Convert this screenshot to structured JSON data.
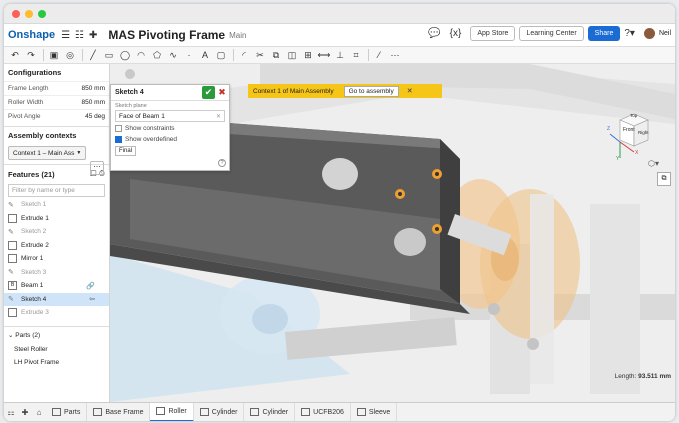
{
  "app": {
    "logo": "Onshape",
    "title": "MAS Pivoting Frame",
    "workspace": "Main",
    "app_store": "App Store",
    "learning_center": "Learning Center",
    "share": "Share",
    "user": "Neil"
  },
  "toolbar_icons": [
    "undo-icon",
    "redo-icon",
    "sketch-icon",
    "line-icon",
    "rectangle-icon",
    "circle-icon",
    "arc-icon",
    "polygon-icon",
    "spline-icon",
    "point-icon",
    "text-icon",
    "image-icon",
    "fillet-icon",
    "trim-icon",
    "offset-icon",
    "mirror-icon",
    "pattern-icon",
    "dimension-icon",
    "constraint-icon"
  ],
  "configurations": {
    "title": "Configurations",
    "rows": [
      {
        "label": "Frame Length",
        "value": "850 mm"
      },
      {
        "label": "Roller Width",
        "value": "850 mm"
      },
      {
        "label": "Pivot Angle",
        "value": "45 deg"
      }
    ]
  },
  "assembly_contexts": {
    "title": "Assembly contexts",
    "value": "Context 1 – Main Ass"
  },
  "features": {
    "title": "Features (21)",
    "filter_placeholder": "Filter by name or type",
    "items": [
      {
        "label": "Sketch 1",
        "kind": "sketch",
        "dim": true
      },
      {
        "label": "Extrude 1",
        "kind": "extrude",
        "dim": false
      },
      {
        "label": "Sketch 2",
        "kind": "sketch",
        "dim": true
      },
      {
        "label": "Extrude 2",
        "kind": "extrude",
        "dim": false
      },
      {
        "label": "Mirror 1",
        "kind": "mirror",
        "dim": false
      },
      {
        "label": "Sketch 3",
        "kind": "sketch",
        "dim": true
      },
      {
        "label": "Beam 1",
        "kind": "beam",
        "dim": false
      },
      {
        "label": "Sketch 4",
        "kind": "sketch",
        "dim": false,
        "selected": true
      },
      {
        "label": "Extrude 3",
        "kind": "extrude",
        "dim": true
      }
    ]
  },
  "parts": {
    "title": "Parts (2)",
    "items": [
      "Steel Roller",
      "LH Pivot Frame"
    ]
  },
  "sketch_panel": {
    "title": "Sketch 4",
    "plane_label": "Sketch plane",
    "plane_value": "Face of Beam 1",
    "show_constraints": "Show constraints",
    "show_overdefined": "Show overdefined",
    "final": "Final"
  },
  "context_bar": {
    "text": "Context 1 of Main Assembly",
    "button": "Go to assembly"
  },
  "cube": {
    "top": "Top",
    "front": "Front",
    "right": "Right",
    "x": "X",
    "y": "Y",
    "z": "Z"
  },
  "length": {
    "label": "Length:",
    "value": "93.511 mm"
  },
  "bottom_tabs": [
    {
      "label": "Parts",
      "active": false
    },
    {
      "label": "Base Frame",
      "active": false
    },
    {
      "label": "Roller",
      "active": true
    },
    {
      "label": "Cylinder",
      "active": false
    },
    {
      "label": "Cylinder",
      "active": false
    },
    {
      "label": "UCFB206",
      "active": false
    },
    {
      "label": "Sleeve",
      "active": false
    }
  ],
  "colors": {
    "accent": "#1a6bd4",
    "context_bar": "#f5c518",
    "selection": "#cfe4f9",
    "confirm": "#2b9a3a",
    "cancel": "#c9302c"
  }
}
